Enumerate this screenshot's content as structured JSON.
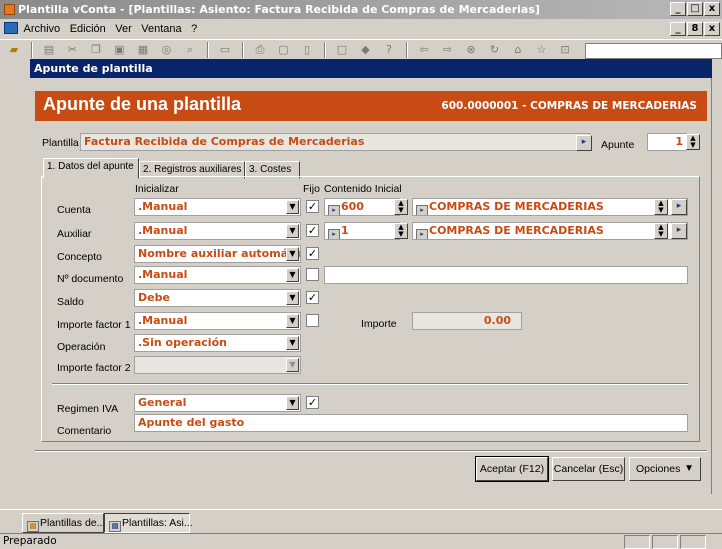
{
  "window": {
    "title": "Plantilla vConta - [Plantillas: Asiento: Factura Recibida de Compras de Mercaderias]",
    "controls": [
      "_",
      "□",
      "x"
    ]
  },
  "menu": {
    "items": [
      "Archivo",
      "Edición",
      "Ver",
      "Ventana",
      "?"
    ],
    "mdi_controls": [
      "_",
      "8",
      "x"
    ]
  },
  "dialog": {
    "title": "Apunte de plantilla",
    "banner_title": "Apunte de una plantilla",
    "banner_code": "600.0000001 - COMPRAS DE MERCADERIAS",
    "plantilla_label": "Plantilla",
    "plantilla_value": "Factura Recibida de Compras de Mercaderias",
    "apunte_label": "Apunte",
    "apunte_value": "1"
  },
  "tabs": [
    {
      "label": "1. Datos del apunte",
      "active": true
    },
    {
      "label": "2. Registros auxiliares",
      "active": false
    },
    {
      "label": "3. Costes",
      "active": false
    }
  ],
  "columns": {
    "inicializar": "Inicializar",
    "fijo": "Fijo",
    "contenido": "Contenido Inicial"
  },
  "rows": {
    "cuenta": {
      "label": "Cuenta",
      "init": ".Manual",
      "fijo": true,
      "content_code": "600",
      "content_desc": "COMPRAS DE MERCADERIAS"
    },
    "auxiliar": {
      "label": "Auxiliar",
      "init": ".Manual",
      "fijo": true,
      "content_code": "1",
      "content_desc": "COMPRAS DE MERCADERIAS"
    },
    "concepto": {
      "label": "Concepto",
      "init": "Nombre auxiliar automático",
      "fijo": true
    },
    "documento": {
      "label": "Nº documento",
      "init": ".Manual",
      "fijo": false,
      "content": ""
    },
    "saldo": {
      "label": "Saldo",
      "init": "Debe",
      "fijo": true
    },
    "importe1": {
      "label": "Importe factor 1",
      "init": ".Manual",
      "fijo": false,
      "importe_label": "Importe",
      "importe_value": "0.00"
    },
    "operacion": {
      "label": "Operación",
      "init": ".Sin operación"
    },
    "importe2": {
      "label": "Importe factor 2",
      "init": ""
    },
    "regimen": {
      "label": "Regimen IVA",
      "init": "General",
      "fijo": true
    },
    "comentario": {
      "label": "Comentario",
      "value": "Apunte del gasto"
    }
  },
  "buttons": {
    "aceptar": "Aceptar (F12)",
    "cancelar": "Cancelar (Esc)",
    "opciones": "Opciones"
  },
  "taskbar": {
    "items": [
      "Plantillas de...",
      "Plantillas: Asi..."
    ]
  },
  "status": {
    "text": "Preparado"
  },
  "colors": {
    "accent": "#c84b14",
    "dialog_title": "#0a246a",
    "face": "#d4d0c8"
  }
}
